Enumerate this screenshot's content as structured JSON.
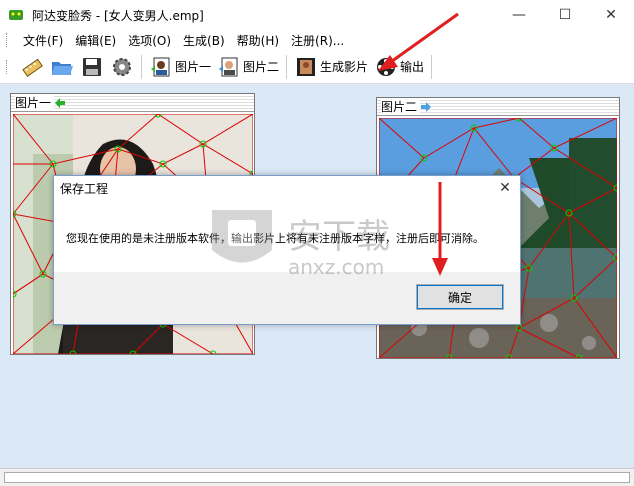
{
  "window": {
    "title": "阿达变脸秀 - [女人变男人.emp]",
    "minimize": "—",
    "maximize": "☐",
    "close": "✕"
  },
  "menu": [
    "文件(F)",
    "编辑(E)",
    "选项(O)",
    "生成(B)",
    "帮助(H)",
    "注册(R)..."
  ],
  "toolbar": {
    "pic1": "图片一",
    "pic2": "图片二",
    "generate": "生成影片",
    "output": "输出"
  },
  "panels": {
    "left_title": "图片一",
    "right_title": "图片二"
  },
  "dialog": {
    "title": "保存工程",
    "message": "您现在使用的是未注册版本软件，输出影片上将有未注册版本字样，注册后即可消除。",
    "ok": "确定",
    "close": "✕"
  },
  "watermark": {
    "text": "安下载",
    "sub": "anxz.com"
  },
  "colors": {
    "client_bg": "#dbe8f6",
    "mesh_line": "#e00000",
    "mesh_point": "#00cc00",
    "arrow": "#e02020"
  }
}
